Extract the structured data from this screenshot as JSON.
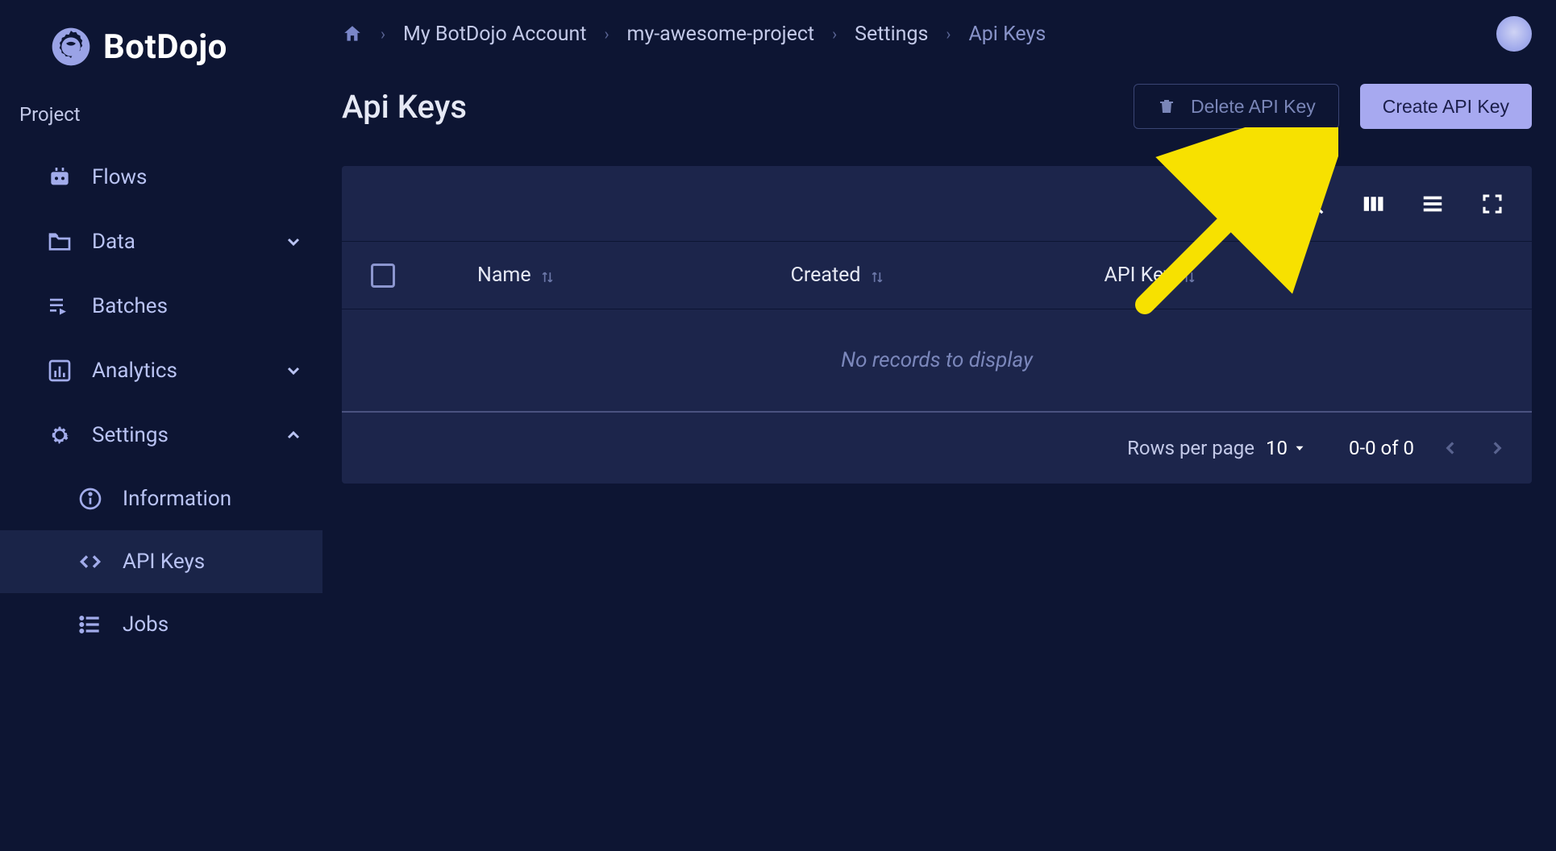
{
  "brand": {
    "name": "BotDojo"
  },
  "sidebar": {
    "section_label": "Project",
    "items": {
      "flows": "Flows",
      "data": "Data",
      "batches": "Batches",
      "analytics": "Analytics",
      "settings": "Settings"
    },
    "settings_children": {
      "information": "Information",
      "api_keys": "API Keys",
      "jobs": "Jobs"
    }
  },
  "breadcrumb": {
    "account": "My BotDojo Account",
    "project": "my-awesome-project",
    "settings": "Settings",
    "current": "Api Keys"
  },
  "page": {
    "title": "Api Keys",
    "delete_button": "Delete API Key",
    "create_button": "Create API Key"
  },
  "table": {
    "columns": {
      "name": "Name",
      "created": "Created",
      "api_key": "API Key"
    },
    "empty_text": "No records to display"
  },
  "pagination": {
    "rows_label": "Rows per page",
    "page_size": "10",
    "range_text": "0-0 of 0"
  }
}
